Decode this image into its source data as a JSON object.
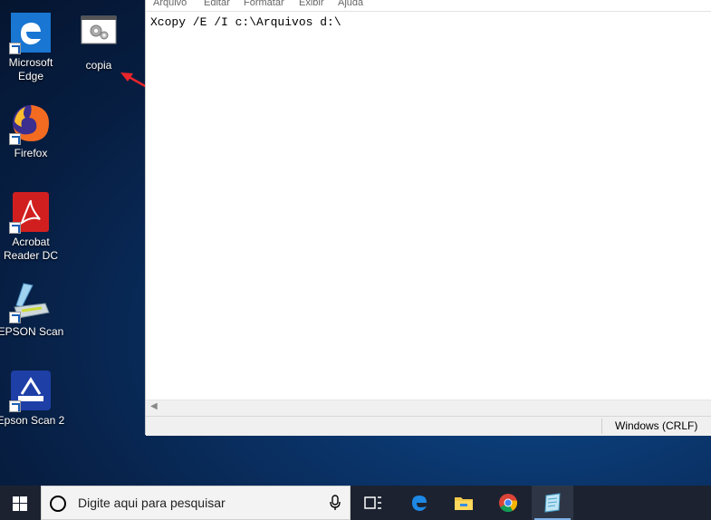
{
  "desktop": {
    "icons": [
      {
        "label": "Microsoft\nEdge",
        "icon": "edge-icon"
      },
      {
        "label": "copia",
        "icon": "batch-file-icon"
      },
      {
        "label": "Firefox",
        "icon": "firefox-icon"
      },
      {
        "label": "Acrobat\nReader DC",
        "icon": "acrobat-icon"
      },
      {
        "label": "EPSON Scan",
        "icon": "epson-scan-icon"
      },
      {
        "label": "Epson Scan 2",
        "icon": "epson-scan2-icon"
      }
    ]
  },
  "notepad": {
    "menu": [
      "Arquivo",
      "Editar",
      "Formatar",
      "Exibir",
      "Ajuda"
    ],
    "content": "Xcopy /E /I c:\\Arquivos d:\\",
    "status_encoding": "Windows (CRLF)"
  },
  "taskbar": {
    "search_placeholder": "Digite aqui para pesquisar",
    "apps": [
      "task-view-icon",
      "edge-icon",
      "file-explorer-icon",
      "chrome-icon",
      "notepad-icon"
    ]
  },
  "colors": {
    "annotation_arrow": "#e8252a",
    "taskbar": "#1c2230",
    "notepad_bg": "#ffffff"
  }
}
